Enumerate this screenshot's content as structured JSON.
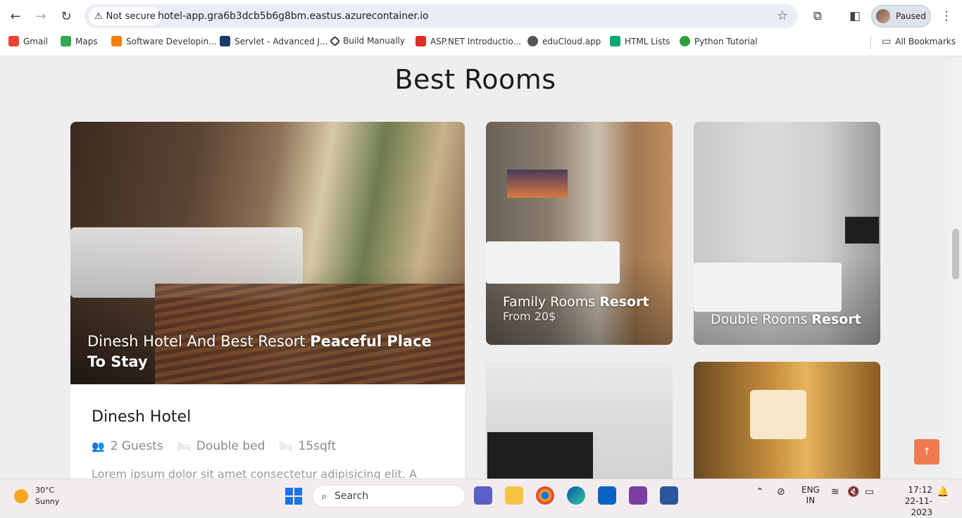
{
  "browser": {
    "security_label": "Not secure",
    "url": "hotel-app.gra6b3dcb5b6g8bm.eastus.azurecontainer.io",
    "profile_label": "Paused"
  },
  "bookmarks": [
    {
      "label": "Gmail",
      "icon": "gmail-icon",
      "color": "#ea4335"
    },
    {
      "label": "Maps",
      "icon": "maps-icon",
      "color": "#34a853"
    },
    {
      "label": "Software Developin...",
      "icon": "blogger-icon",
      "color": "#f57d00"
    },
    {
      "label": "Servlet - Advanced J...",
      "icon": "site-icon",
      "color": "#1b3a6b"
    },
    {
      "label": "Build Manually",
      "icon": "diamond-icon",
      "color": "#333333"
    },
    {
      "label": "ASP.NET Introductio...",
      "icon": "csharp-icon",
      "color": "#d93025"
    },
    {
      "label": "eduCloud.app",
      "icon": "globe-icon",
      "color": "#555555"
    },
    {
      "label": "HTML Lists",
      "icon": "w3-icon",
      "color": "#04aa6d"
    },
    {
      "label": "Python Tutorial",
      "icon": "python-icon",
      "color": "#2e9d3a"
    }
  ],
  "all_bookmarks_label": "All Bookmarks",
  "page": {
    "section_title": "Best Rooms",
    "featured": {
      "caption_regular": "Dinesh Hotel And Best Resort ",
      "caption_bold": "Peaceful Place To Stay",
      "name": "Dinesh Hotel",
      "features": [
        {
          "icon": "users-icon",
          "label": "2 Guests"
        },
        {
          "icon": "bed-icon",
          "label": "Double bed"
        },
        {
          "icon": "area-icon",
          "label": "15sqft"
        }
      ],
      "description": "Lorem ipsum dolor sit amet consectetur adipisicing elit. A"
    },
    "rooms": [
      {
        "title_regular": "Family Rooms ",
        "title_bold": "Resort",
        "price": "From 20$"
      },
      {
        "title_regular": "Double Rooms ",
        "title_bold": "Resort"
      }
    ]
  },
  "taskbar": {
    "weather_temp": "30°C",
    "weather_desc": "Sunny",
    "search_placeholder": "Search",
    "lang_line1": "ENG",
    "lang_line2": "IN",
    "time": "17:12",
    "date": "22-11-2023"
  },
  "colors": {
    "accent": "#f07a4f",
    "page_bg": "#efeeee"
  }
}
